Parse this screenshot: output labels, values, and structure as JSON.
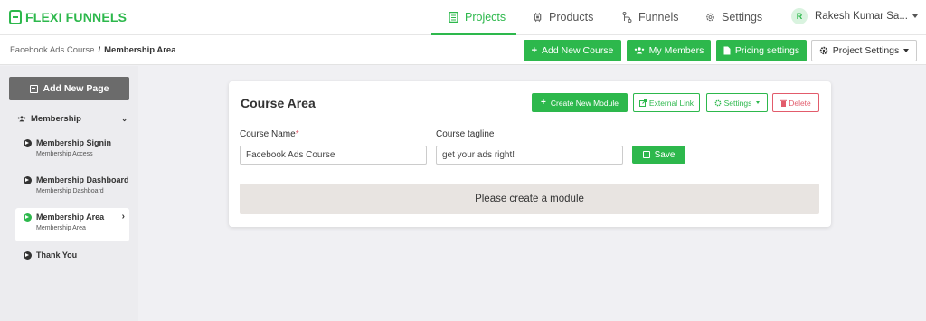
{
  "brand": {
    "name_part1": "FLEXI",
    "name_part2": "FUNNELS"
  },
  "nav": {
    "items": [
      {
        "label": "Projects",
        "icon": "document-icon"
      },
      {
        "label": "Products",
        "icon": "chip-icon"
      },
      {
        "label": "Funnels",
        "icon": "funnel-branch-icon"
      },
      {
        "label": "Settings",
        "icon": "gear-icon"
      }
    ],
    "active": "Projects"
  },
  "user": {
    "initial": "R",
    "name": "Rakesh Kumar Sa..."
  },
  "breadcrumb": {
    "parent": "Facebook Ads Course",
    "separator": "/",
    "current": "Membership Area"
  },
  "toolbar": {
    "add_course": "Add New Course",
    "members": "My Members",
    "pricing": "Pricing settings",
    "project_settings": "Project Settings"
  },
  "sidebar": {
    "add_page": "Add New Page",
    "group_label": "Membership",
    "pages": [
      {
        "title": "Membership Signin",
        "subtitle": "Membership Access"
      },
      {
        "title": "Membership Dashboard",
        "subtitle": "Membership Dashboard"
      },
      {
        "title": "Membership Area",
        "subtitle": "Membership Area",
        "active": true
      },
      {
        "title": "Thank You",
        "subtitle": ""
      }
    ]
  },
  "course": {
    "title": "Course Area",
    "create_module": "Create New Module",
    "external_link": "External Link",
    "settings": "Settings",
    "delete": "Delete",
    "name_label": "Course Name",
    "name_required": "*",
    "name_value": "Facebook Ads Course",
    "tagline_label": "Course tagline",
    "tagline_value": "get your ads right!",
    "save": "Save",
    "empty_message": "Please create a module"
  },
  "colors": {
    "accent": "#2db84c",
    "danger": "#e25b6b",
    "sidebar_button": "#6b6b6b"
  }
}
